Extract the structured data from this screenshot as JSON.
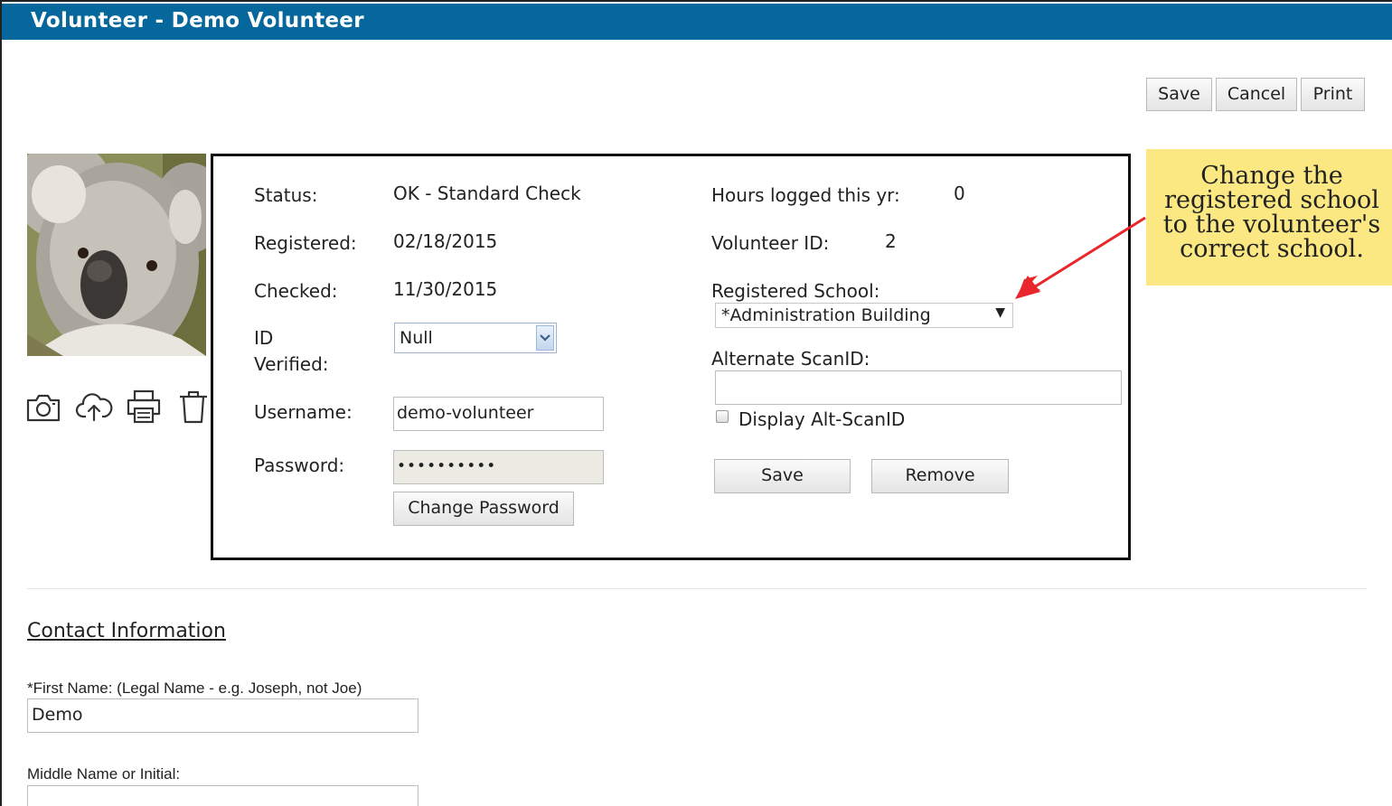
{
  "window": {
    "title": "Volunteer - Demo Volunteer"
  },
  "toolbar": {
    "save_label": "Save",
    "cancel_label": "Cancel",
    "print_label": "Print"
  },
  "photo_tools": {
    "icons": [
      "camera-icon",
      "upload-cloud-icon",
      "printer-icon",
      "trash-icon"
    ]
  },
  "details": {
    "status_label": "Status:",
    "status_value": "OK - Standard Check",
    "registered_label": "Registered:",
    "registered_value": "02/18/2015",
    "checked_label": "Checked:",
    "checked_value": "11/30/2015",
    "id_verified_label_1": "ID",
    "id_verified_label_2": "Verified:",
    "id_verified_value": "Null",
    "username_label": "Username:",
    "username_value": "demo-volunteer",
    "password_label": "Password:",
    "password_value": "••••••••••",
    "change_password_label": "Change Password",
    "hours_label": "Hours logged this yr:",
    "hours_value": "0",
    "volunteer_id_label": "Volunteer ID:",
    "volunteer_id_value": "2",
    "school_label": "Registered School:",
    "school_value": "*Administration Building",
    "alt_scanid_label": "Alternate ScanID:",
    "alt_scanid_value": "",
    "display_alt_label": "Display Alt-ScanID",
    "display_alt_checked": false,
    "save_label": "Save",
    "remove_label": "Remove"
  },
  "annotation": {
    "line1": "Change the",
    "line2": "registered school",
    "line3": "to the volunteer's",
    "line4": "correct school.",
    "color": "#fbe882",
    "arrow_color": "#e8262b"
  },
  "contact": {
    "section_title": "Contact Information",
    "first_name_label": "*First Name: (Legal Name - e.g. Joseph, not Joe)",
    "first_name_value": "Demo",
    "middle_name_label": "Middle Name or Initial:",
    "middle_name_value": ""
  },
  "colors": {
    "titlebar": "#05679c",
    "panel_border": "#111111"
  }
}
